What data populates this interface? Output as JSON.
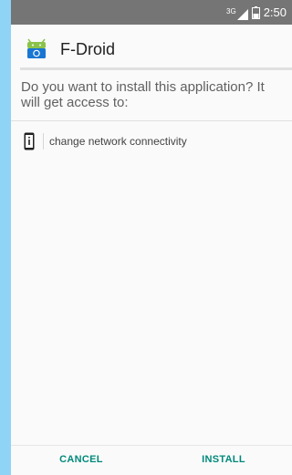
{
  "status_bar": {
    "network_label": "3G",
    "time": "2:50",
    "signal_icon": "signal-icon",
    "battery_icon": "battery-icon"
  },
  "header": {
    "app_icon": "fdroid-app-icon",
    "app_name": "F-Droid"
  },
  "prompt": {
    "question": "Do you want to install this application? It will get access to:"
  },
  "permissions": [
    {
      "icon": "phone-info-icon",
      "label": "change network connectivity"
    }
  ],
  "actions": {
    "cancel_label": "CANCEL",
    "install_label": "INSTALL"
  },
  "colors": {
    "status_bar": "#757575",
    "accent": "#00897b",
    "background": "#fafafa",
    "side_strip": "#8fd3f5"
  }
}
